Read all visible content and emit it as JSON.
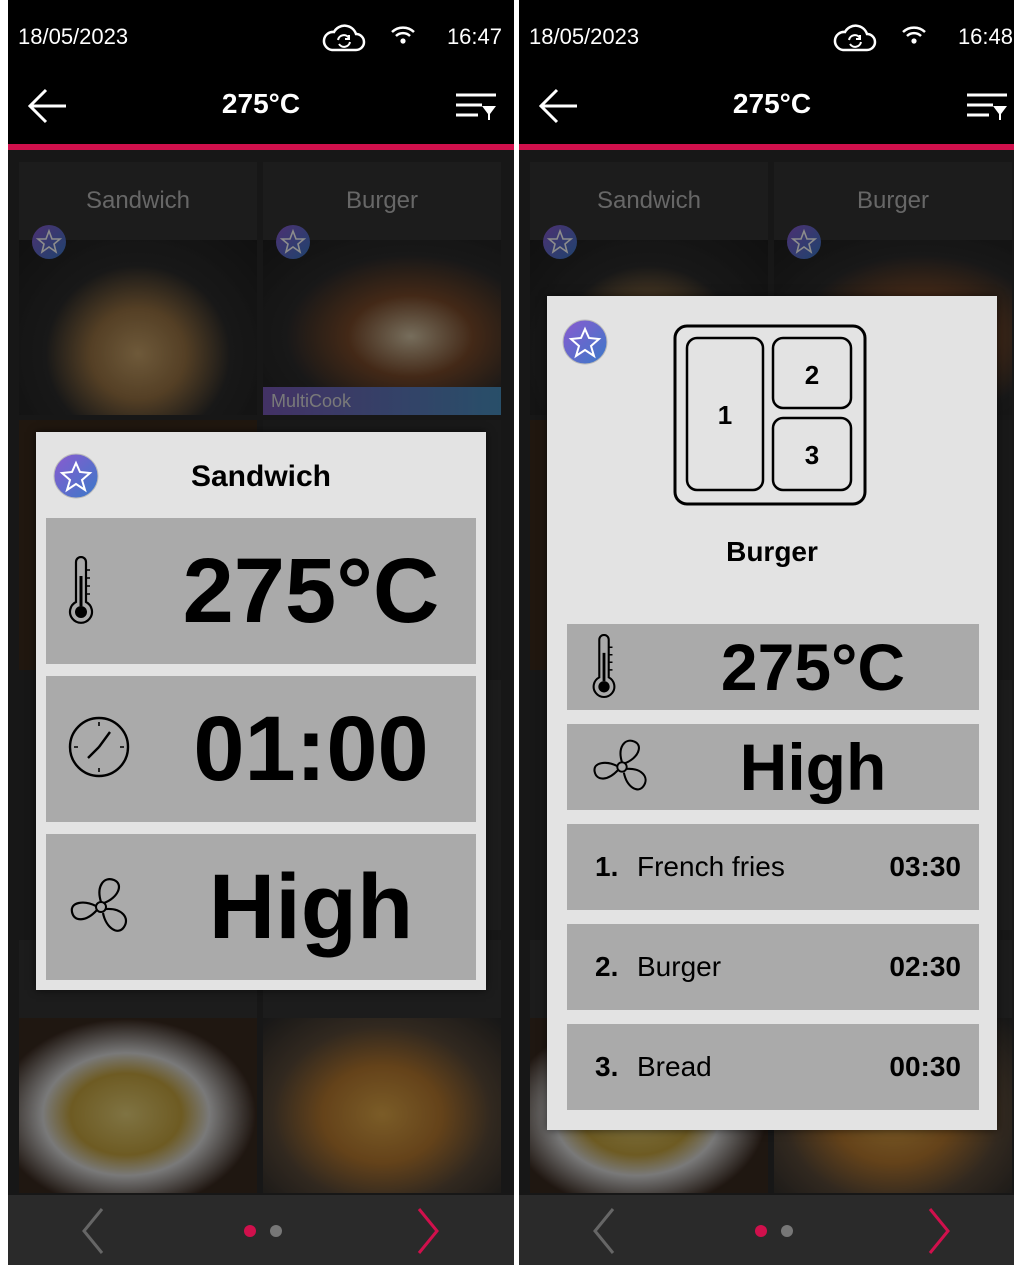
{
  "screens": [
    {
      "status": {
        "date": "18/05/2023",
        "time": "16:47"
      },
      "header": {
        "title": "275°C"
      },
      "grid_tiles": [
        {
          "label": "Sandwich",
          "badge": ""
        },
        {
          "label": "Burger",
          "badge": "MultiCook"
        }
      ],
      "popup": {
        "title": "Sandwich",
        "temperature": "275°C",
        "duration": "01:00",
        "fan": "High"
      },
      "pagination": {
        "pages": 2,
        "active": 1
      }
    },
    {
      "status": {
        "date": "18/05/2023",
        "time": "16:48"
      },
      "header": {
        "title": "275°C"
      },
      "grid_tiles": [
        {
          "label": "Sandwich",
          "badge": ""
        },
        {
          "label": "Burger",
          "badge": ""
        }
      ],
      "popup": {
        "title": "Burger",
        "temperature": "275°C",
        "fan": "High",
        "tray_slots": [
          "1",
          "2",
          "3"
        ],
        "steps": [
          {
            "num": "1.",
            "name": "French fries",
            "time": "03:30"
          },
          {
            "num": "2.",
            "name": "Burger",
            "time": "02:30"
          },
          {
            "num": "3.",
            "name": "Bread",
            "time": "00:30"
          }
        ]
      },
      "pagination": {
        "pages": 2,
        "active": 1
      }
    }
  ],
  "colors": {
    "accent": "#d0104c",
    "popup_bg": "#e3e3e3",
    "row_bg": "#aaaaaa",
    "header_bg": "#000000"
  },
  "icons": [
    "back-arrow-icon",
    "filter-icon",
    "cloud-sync-icon",
    "wifi-icon",
    "star-icon",
    "thermometer-icon",
    "clock-icon",
    "fan-icon",
    "chevron-left-icon",
    "chevron-right-icon"
  ]
}
